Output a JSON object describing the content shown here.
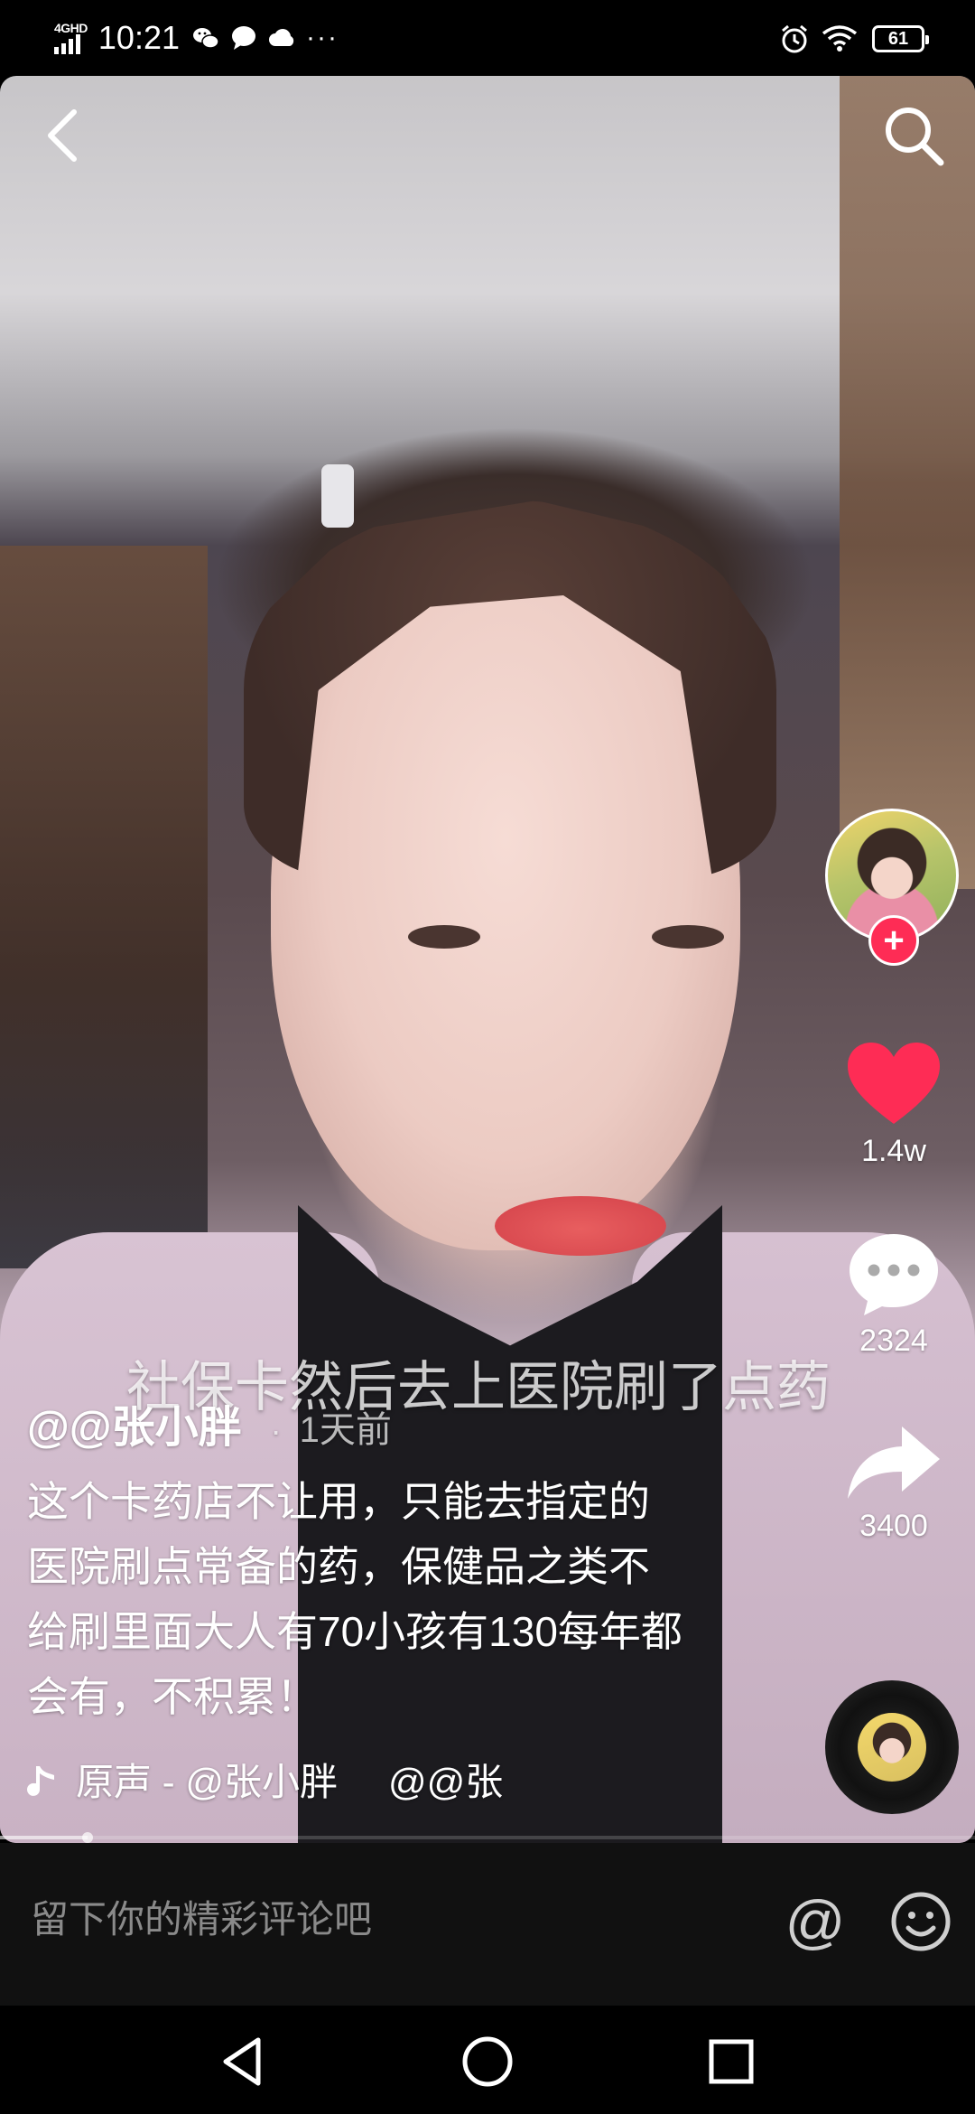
{
  "status_bar": {
    "network": "4GHD",
    "time": "10:21",
    "more": "···",
    "battery": "61"
  },
  "video": {
    "subtitle": "社保卡然后去上医院刷了点药"
  },
  "actions": {
    "follow": "+",
    "likes": "1.4w",
    "comments": "2324",
    "shares": "3400"
  },
  "caption": {
    "author": "@@张小胖",
    "dot": "·",
    "time_ago": "1天前",
    "description": "这个卡药店不让用，只能去指定的医院刷点常备的药，保健品之类不给刷里面大人有70小孩有130每年都会有，不积累！"
  },
  "music": {
    "label": "原声 - @张小胖",
    "label2": "@@张"
  },
  "progress": {
    "fraction": 0.09
  },
  "comment": {
    "placeholder": "留下你的精彩评论吧",
    "mention": "@"
  },
  "icons": {
    "back": "chevron-left-icon",
    "search": "search-icon",
    "like": "heart-icon",
    "comment": "comment-bubble-icon",
    "share": "share-arrow-icon",
    "music": "music-note-icon",
    "emoji": "smiley-icon"
  },
  "colors": {
    "like": "#fe2c55",
    "follow": "#fe2c55",
    "comment_bar": "#111111"
  }
}
